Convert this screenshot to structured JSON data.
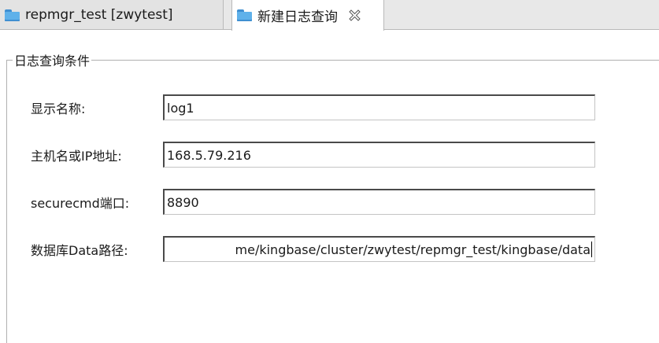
{
  "tabs": [
    {
      "label": "repmgr_test [zwytest]",
      "icon": "folder-icon",
      "active": false
    },
    {
      "label": "新建日志查询",
      "icon": "folder-icon",
      "active": true,
      "close_glyph": "⊠"
    }
  ],
  "group": {
    "legend": "日志查询条件",
    "fields": [
      {
        "label": "显示名称:",
        "value": "log1"
      },
      {
        "label": "主机名或IP地址:",
        "value": "168.5.79.216"
      },
      {
        "label": "securecmd端口:",
        "value": "8890"
      },
      {
        "label": "数据库Data路径:",
        "value": "me/kingbase/cluster/zwytest/repmgr_test/kingbase/data"
      }
    ]
  },
  "colors": {
    "folder": "#5fb1ea",
    "tabbar": "#e8e8e8"
  }
}
